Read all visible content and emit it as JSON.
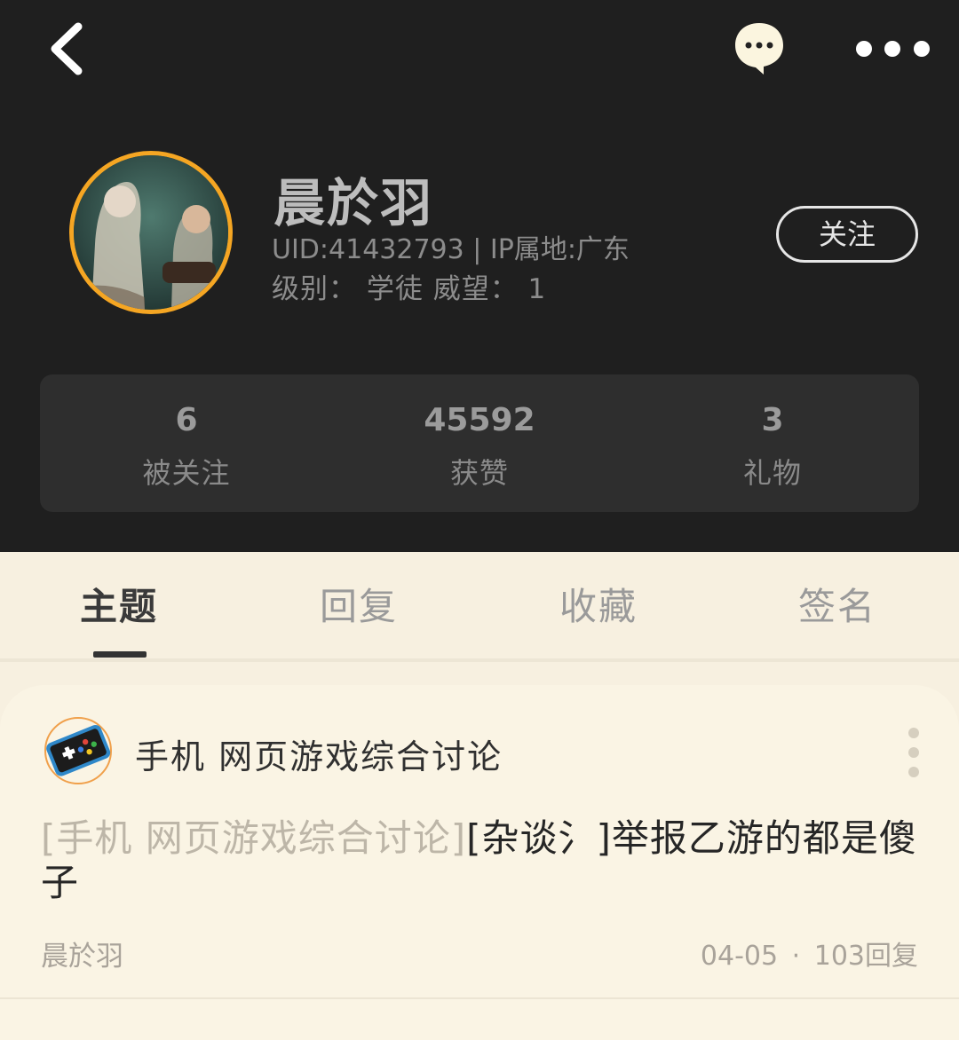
{
  "header": {
    "icons": {
      "back": "chevron-left-icon",
      "chat": "chat-bubble-icon",
      "more": "more-horizontal-icon"
    }
  },
  "profile": {
    "name": "晨於羽",
    "uid_line": "UID:41432793 | IP属地:广东",
    "level_line": "级别： 学徒   威望： 1",
    "follow_label": "关注",
    "avatar_ring_color": "#f5a623"
  },
  "stats": [
    {
      "value": "6",
      "label": "被关注"
    },
    {
      "value": "45592",
      "label": "获赞"
    },
    {
      "value": "3",
      "label": "礼物"
    }
  ],
  "tabs": [
    {
      "label": "主题",
      "active": true
    },
    {
      "label": "回复",
      "active": false
    },
    {
      "label": "收藏",
      "active": false
    },
    {
      "label": "签名",
      "active": false
    }
  ],
  "post": {
    "forum_name": "手机 网页游戏综合讨论",
    "title_prefix": "[手机 网页游戏综合讨论]",
    "title_main": "[杂谈氵]举报乙游的都是傻子",
    "author": "晨於羽",
    "date": "04-05",
    "separator": "·",
    "replies": "103回复"
  }
}
